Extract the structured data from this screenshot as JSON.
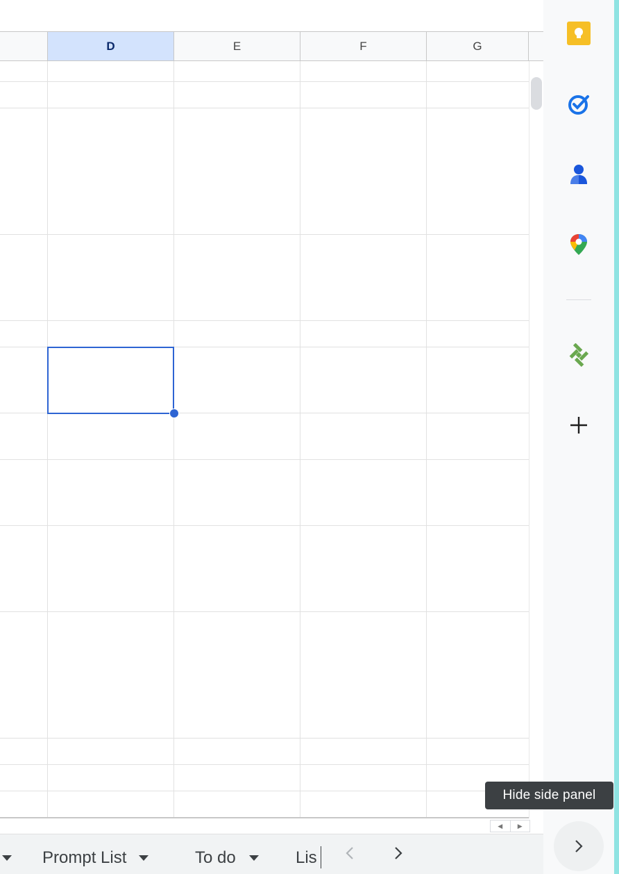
{
  "spreadsheet": {
    "columns": [
      {
        "label": "D",
        "selected": true
      },
      {
        "label": "E",
        "selected": false
      },
      {
        "label": "F",
        "selected": false
      },
      {
        "label": "G",
        "selected": false
      }
    ]
  },
  "sheet_tabs": {
    "tabs": [
      {
        "label": "Prompt List"
      },
      {
        "label": "To do"
      },
      {
        "label": "Lis"
      }
    ],
    "prev_icon": "chevron-left-icon",
    "next_icon": "chevron-right-icon"
  },
  "side_panel": {
    "apps": [
      "keep-icon",
      "tasks-icon",
      "contacts-icon",
      "maps-icon",
      "addon-icon",
      "add-icon"
    ],
    "tooltip": "Hide side panel",
    "hide_button_icon": "chevron-right-icon"
  },
  "colors": {
    "selection": "#2d64d3",
    "selected_header": "#d3e3fd",
    "keep_yellow": "#f6bf26",
    "tasks_blue": "#1a73e8",
    "addon_green": "#6aa84f",
    "edge_accent": "#8fe3e2"
  }
}
